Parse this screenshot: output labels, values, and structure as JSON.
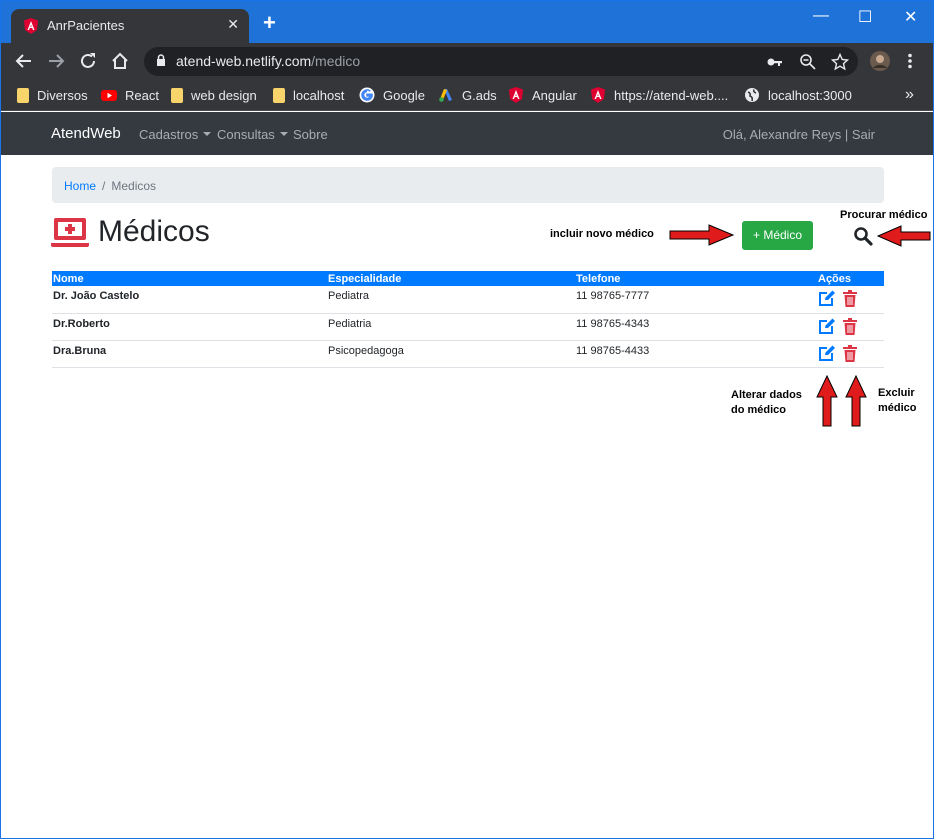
{
  "browser": {
    "tab_title": "AnrPacientes",
    "url_host": "atend-web.netlify.com",
    "url_path": "/medico",
    "bookmarks": [
      {
        "label": "Diversos",
        "icon": "folder-icon"
      },
      {
        "label": "React",
        "icon": "youtube-icon"
      },
      {
        "label": "web design",
        "icon": "folder-icon"
      },
      {
        "label": "localhost",
        "icon": "folder-icon"
      },
      {
        "label": "Google",
        "icon": "google-icon"
      },
      {
        "label": "G.ads",
        "icon": "google-ads-icon"
      },
      {
        "label": "Angular",
        "icon": "angular-icon"
      },
      {
        "label": "https://atend-web....",
        "icon": "angular-icon"
      },
      {
        "label": "localhost:3000",
        "icon": "globe-icon"
      }
    ],
    "bookmarks_overflow": "»",
    "newtab_label": "+",
    "close_label": "✕",
    "minimize_label": "—",
    "restore_label": "☐",
    "window_close_label": "✕"
  },
  "app": {
    "brand": "AtendWeb",
    "nav": [
      "Cadastros",
      "Consultas",
      "Sobre"
    ],
    "user_text": "Olá, Alexandre Reys | Sair"
  },
  "breadcrumb": {
    "home": "Home",
    "separator": "/",
    "current": "Medicos"
  },
  "page": {
    "title": "Médicos",
    "add_button": "+ Médico"
  },
  "annotations": {
    "add": "incluir novo médico",
    "search": "Procurar médico",
    "edit_line1": "Alterar dados",
    "edit_line2": "do médico",
    "delete_line1": "Excluir",
    "delete_line2": "médico"
  },
  "table": {
    "headers": [
      "Nome",
      "Especialidade",
      "Telefone",
      "Ações"
    ],
    "rows": [
      {
        "nome": "Dr. João Castelo",
        "especialidade": "Pediatra",
        "telefone": "11 98765-7777"
      },
      {
        "nome": "Dr.Roberto",
        "especialidade": "Pediatria",
        "telefone": "11 98765-4343"
      },
      {
        "nome": "Dra.Bruna",
        "especialidade": "Psicopedagoga",
        "telefone": "11 98765-4433"
      }
    ]
  },
  "colors": {
    "chrome_titlebar": "#1f73d8",
    "navbar": "#343a40",
    "primary": "#007bff",
    "success": "#28a745",
    "danger": "#dc3545",
    "arrow": "#e01b1b"
  }
}
